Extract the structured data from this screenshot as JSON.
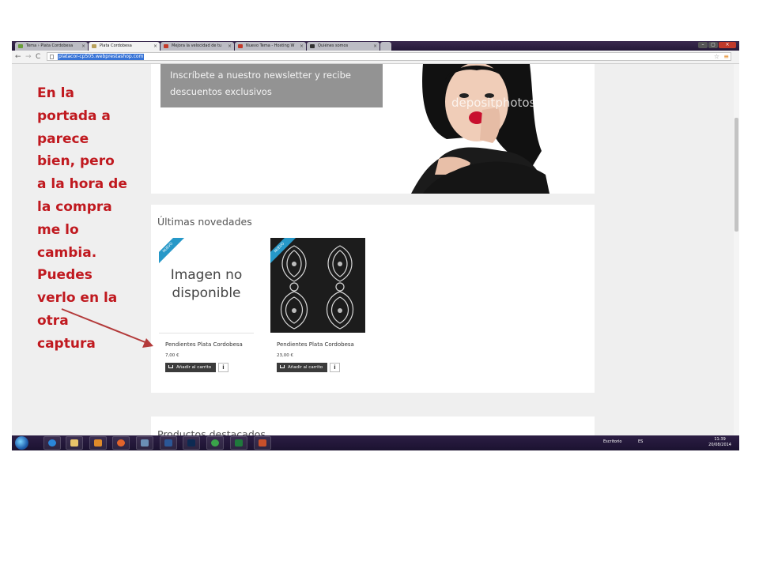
{
  "browser": {
    "tabs": [
      {
        "label": "Tema › Plata Cordobesa",
        "active": false
      },
      {
        "label": "Plata Cordobesa",
        "active": true
      },
      {
        "label": "Mejora la velocidad de tu",
        "active": false
      },
      {
        "label": "Nuevo Tema - Hosting W",
        "active": false
      },
      {
        "label": "Quiénes somos",
        "active": false
      }
    ],
    "url": "platacor-cp505.webprestashop.com"
  },
  "page": {
    "newsletter_text": "Inscríbete a nuestro newsletter y recibe descuentos exclusivos",
    "watermark": "depositphotos",
    "section_title": "Últimas novedades",
    "next_section_title": "Productos destacados",
    "products": [
      {
        "badge": "NUEVO",
        "image_placeholder": "Imagen no disponible",
        "name": "Pendientes Plata Cordobesa",
        "price": "7,00 €",
        "cart_label": "Añadir al carrito",
        "info_label": "i"
      },
      {
        "badge": "NUEVO",
        "image_placeholder": "",
        "name": "Pendientes Plata Cordobesa",
        "price": "23,00 €",
        "cart_label": "Añadir al carrito",
        "info_label": "i"
      }
    ]
  },
  "taskbar": {
    "desktop_label": "Escritorio",
    "lang": "ES",
    "time": "11:39",
    "date": "20/08/2014"
  },
  "annotation": {
    "text": "En la\nportada a\nparece\nbien, pero\na la hora de\nla compra\nme lo\ncambia.\nPuedes\nverlo en la\notra\ncaptura",
    "color": "#c0191f"
  }
}
